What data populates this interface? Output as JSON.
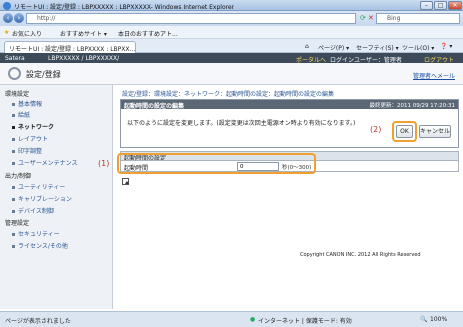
{
  "browser": {
    "title": "リモートUI : 設定/登録 : LBPXXXXX : LBPXXXXX- Windows Internet Explorer",
    "address": "http://",
    "search_placeholder": "Bing",
    "favorites_label": "お気に入り",
    "favorites_items": [
      "おすすめサイト ▾",
      "本日のおすすめアト..."
    ],
    "tab_label": "リモートUI : 設定/登録 : LBPXXXX : LBPXX...",
    "command_page": "ページ(P) ▾",
    "command_safety": "セーフティ(S) ▾",
    "command_tools": "ツール(O) ▾",
    "command_help": "❓ ▾"
  },
  "canon_header": {
    "brand": "Satera",
    "device": "LBPXXXXX / LBPXXXXX/",
    "portal_link": "ポータルへ",
    "login_user": "ログインユーザー：管理者",
    "logout": "ログアウト"
  },
  "page_header": {
    "title": "設定/登録",
    "admin_mail": "管理者へメール"
  },
  "sidebar": {
    "groups": [
      {
        "label": "環境設定",
        "items": [
          "基本情報",
          "給紙",
          "ネットワーク",
          "レイアウト",
          "印字調整",
          "ユーザーメンテナンス"
        ]
      },
      {
        "label": "出力/制御",
        "items": [
          "ユーティリティー",
          "キャリブレーション",
          "デバイス制御"
        ]
      },
      {
        "label": "管理設定",
        "items": [
          "セキュリティー",
          "ライセンス/その他"
        ]
      }
    ],
    "active_item": "ネットワーク"
  },
  "breadcrumb": "設定/登録：環境設定：ネットワーク：起動時間の設定：起動時間の設定の編集",
  "panel": {
    "title": "起動時間の設定の編集",
    "date": "最終更新：2011 09/29 17:20:31",
    "message": "以下のように設定を変更します。(設定変更は次回主電源オン時より有効になります。)",
    "ok_label": "OK",
    "cancel_label": "キャンセル"
  },
  "section": {
    "title": "起動時間の設定",
    "field_label": "起動時間",
    "field_value": "0",
    "field_range": "秒(0～300)"
  },
  "callouts": {
    "field": "(1)",
    "ok": "(2)"
  },
  "copyright": "Copyright CANON INC. 2012 All Rights Reserved",
  "statusbar": {
    "left": "ページが表示されました",
    "zone": "インターネット | 保護モード: 有効",
    "zoom": "100%"
  }
}
